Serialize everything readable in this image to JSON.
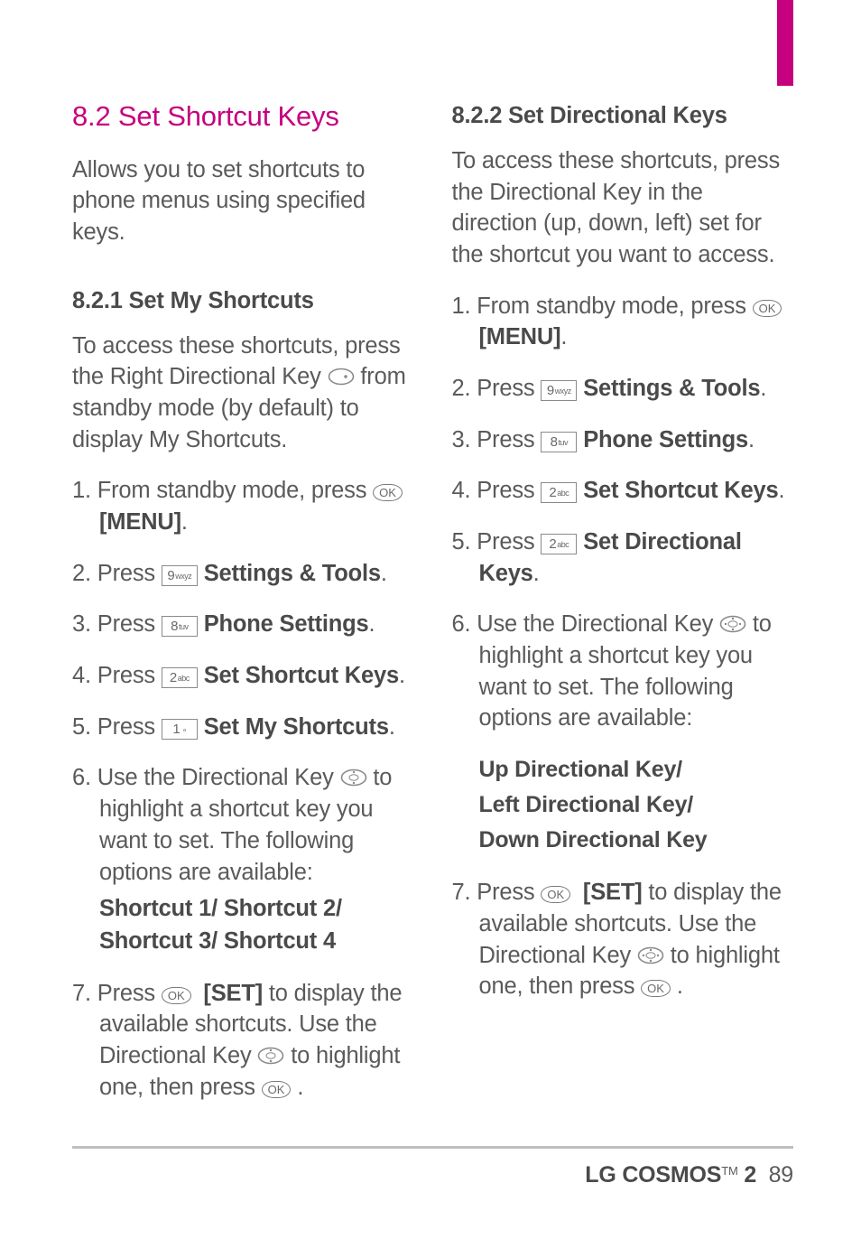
{
  "section": {
    "number": "8.2",
    "title": "Set Shortcut Keys",
    "intro": "Allows you to set shortcuts to phone menus using specified keys."
  },
  "sub1": {
    "number": "8.2.1",
    "title": "Set My Shortcuts",
    "intro": "To access these shortcuts, press the Right Directional Key  from standby mode (by default) to display My Shortcuts.",
    "steps": {
      "s1a": "From standby mode, press ",
      "s1b": "[MENU]",
      "s1c": ".",
      "s2a": "Press ",
      "s2b": "Settings & Tools",
      "s2c": ".",
      "s3a": "Press ",
      "s3b": "Phone Settings",
      "s3c": ".",
      "s4a": "Press ",
      "s4b": "Set Shortcut Keys",
      "s4c": ".",
      "s5a": "Press ",
      "s5b": "Set My Shortcuts",
      "s5c": ".",
      "s6": "Use the Directional Key  to highlight a shortcut key you want to set. The following options are available:",
      "s6sub": "Shortcut 1/ Shortcut 2/ Shortcut 3/ Shortcut 4",
      "s7a": "Press ",
      "s7b": "[SET]",
      "s7c": " to display the available shortcuts. Use the Directional Key  to highlight one, then press ",
      "s7d": "."
    }
  },
  "sub2": {
    "number": "8.2.2",
    "title": "Set Directional Keys",
    "intro": "To access these shortcuts, press the Directional Key in the direction (up, down, left) set for the shortcut you want to access.",
    "steps": {
      "s1a": "From standby mode, press ",
      "s1b": "[MENU]",
      "s1c": ".",
      "s2a": "Press ",
      "s2b": "Settings & Tools",
      "s2c": ".",
      "s3a": "Press ",
      "s3b": "Phone Settings",
      "s3c": ".",
      "s4a": "Press ",
      "s4b": "Set Shortcut Keys",
      "s4c": ".",
      "s5a": "Press ",
      "s5b": "Set Directional Keys",
      "s5c": ".",
      "s6": "Use the Directional Key  to highlight a shortcut key you want to set. The following options are available:",
      "s6sub1": "Up Directional Key/",
      "s6sub2": "Left Directional Key/",
      "s6sub3": "Down Directional Key",
      "s7a": "Press ",
      "s7b": "[SET]",
      "s7c": " to display the available shortcuts. Use the Directional Key  to highlight one, then press ",
      "s7d": "."
    }
  },
  "keys": {
    "ok": "OK",
    "k1n": "1",
    "k1t": "",
    "k2n": "2",
    "k2t": "abc",
    "k8n": "8",
    "k8t": "tuv",
    "k9n": "9",
    "k9t": "wxyz"
  },
  "footer": {
    "brand": "LG COSMOS",
    "tm": "TM",
    "model": "2",
    "page": "89"
  }
}
